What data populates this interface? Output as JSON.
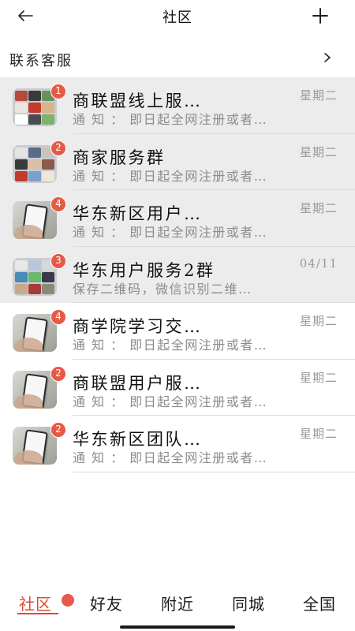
{
  "header": {
    "title": "社区",
    "back_icon": "back-arrow-icon",
    "add_icon": "plus-icon"
  },
  "contact": {
    "label": "联系客服",
    "chevron_icon": "chevron-right-icon"
  },
  "conversations": [
    {
      "name": "商联盟线上服…",
      "preview": "通 知 ： 即日起全网注册或者…",
      "time": "星期二",
      "badge": "1",
      "avatar": "group-collage-avatar"
    },
    {
      "name": "商家服务群",
      "preview": "通 知 ： 即日起全网注册或者…",
      "time": "星期二",
      "badge": "2",
      "avatar": "group-collage-avatar"
    },
    {
      "name": "华东新区用户…",
      "preview": "通 知 ： 即日起全网注册或者…",
      "time": "星期二",
      "badge": "4",
      "avatar": "phone-in-hand-avatar"
    },
    {
      "name": "华东用户服务2群",
      "preview": "保存二维码，微信识别二维…",
      "time": "04/11",
      "badge": "3",
      "avatar": "group-collage-avatar"
    },
    {
      "name": "商学院学习交…",
      "preview": "通 知 ： 即日起全网注册或者…",
      "time": "星期二",
      "badge": "4",
      "avatar": "phone-in-hand-avatar"
    },
    {
      "name": "商联盟用户服…",
      "preview": "通 知 ： 即日起全网注册或者…",
      "time": "星期二",
      "badge": "2",
      "avatar": "phone-in-hand-avatar"
    },
    {
      "name": "华东新区团队…",
      "preview": "通 知 ： 即日起全网注册或者…",
      "time": "星期二",
      "badge": "2",
      "avatar": "phone-in-hand-avatar"
    }
  ],
  "tabs": [
    {
      "label": "社区",
      "active": true
    },
    {
      "label": "好友",
      "active": false
    },
    {
      "label": "附近",
      "active": false
    },
    {
      "label": "同城",
      "active": false
    },
    {
      "label": "全国",
      "active": false
    }
  ],
  "colors": {
    "accent": "#e0493a",
    "badge": "#e65a45",
    "shaded_row": "#ececec",
    "muted_text": "#8c8c8c"
  }
}
